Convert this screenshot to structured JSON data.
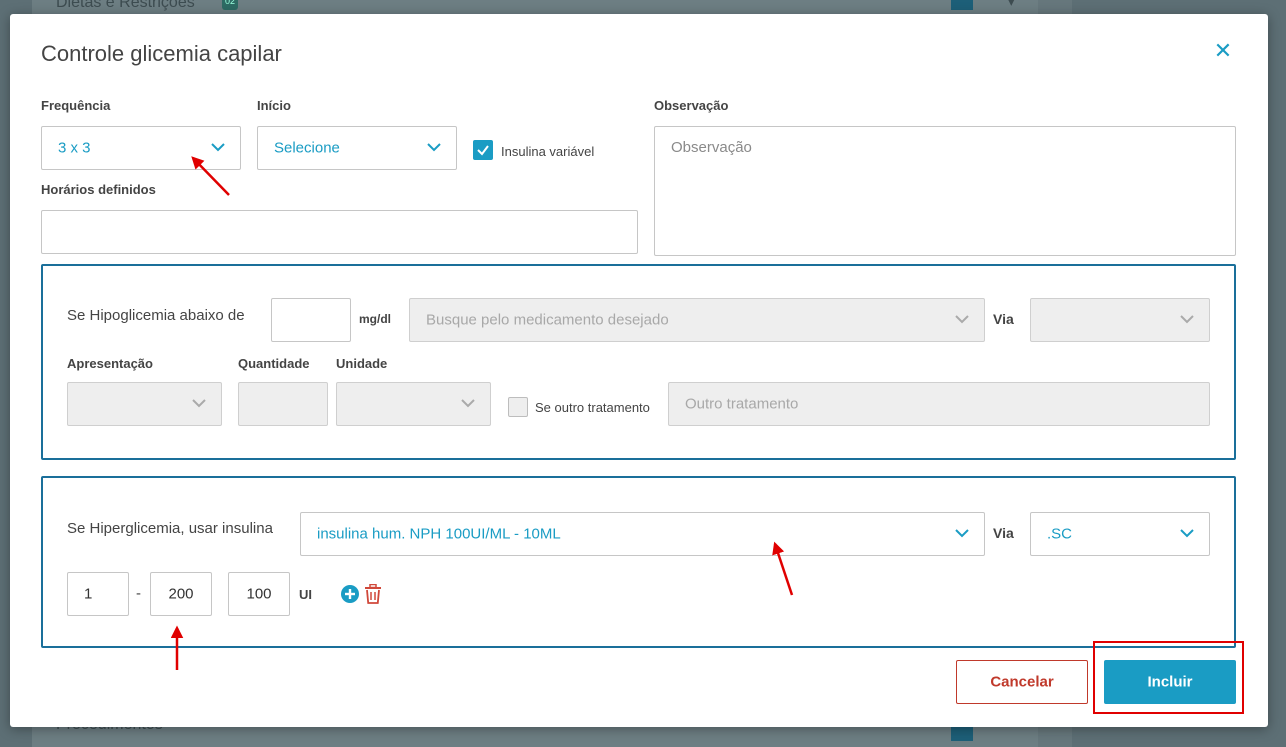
{
  "background": {
    "top_text": "Dietas e Restrições",
    "top_badge": "02",
    "bottom_text": "Procedimentos"
  },
  "modal": {
    "title": "Controle glicemia capilar",
    "close_icon": "close-icon"
  },
  "form": {
    "frequencia": {
      "label": "Frequência",
      "value": "3 x 3"
    },
    "inicio": {
      "label": "Início",
      "value": "Selecione"
    },
    "insulina_variavel": {
      "label": "Insulina variável",
      "checked": true
    },
    "horarios": {
      "label": "Horários definidos",
      "value": ""
    },
    "observacao": {
      "label": "Observação",
      "placeholder": "Observação"
    }
  },
  "hipoglicemia": {
    "label": "Se Hipoglicemia abaixo de",
    "unit": "mg/dl",
    "medicamento_placeholder": "Busque pelo medicamento desejado",
    "via_label": "Via",
    "apresentacao_label": "Apresentação",
    "quantidade_label": "Quantidade",
    "unidade_label": "Unidade",
    "outro_tratamento_check_label": "Se outro tratamento",
    "outro_tratamento_placeholder": "Outro tratamento"
  },
  "hiperglicemia": {
    "label": "Se Hiperglicemia, usar insulina",
    "medicamento_value": "insulina hum. NPH 100UI/ML - 10ML",
    "via_label": "Via",
    "via_value": ".SC",
    "range_from": "1",
    "range_sep": "-",
    "range_to": "200",
    "dose": "100",
    "dose_unit": "UI",
    "add_icon": "plus-circle-icon",
    "delete_icon": "trash-icon"
  },
  "buttons": {
    "cancel": "Cancelar",
    "submit": "Incluir"
  },
  "colors": {
    "accent": "#1a9cc4",
    "section_border": "#1a6f9a",
    "danger": "#c0392b",
    "annotation": "#e00000"
  }
}
